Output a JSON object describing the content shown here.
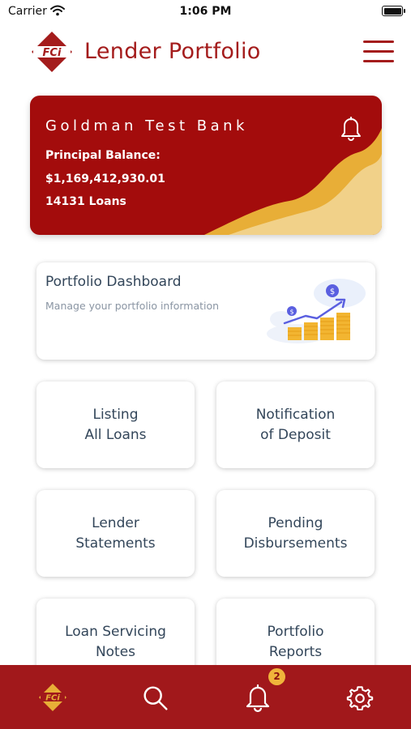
{
  "status_bar": {
    "carrier": "Carrier",
    "time": "1:06 PM"
  },
  "header": {
    "logo_text": "FCi",
    "title": "Lender Portfolio",
    "menu_icon": "hamburger-menu-icon"
  },
  "bank_card": {
    "bank_name": "Goldman Test Bank",
    "principal_label": "Principal Balance:",
    "principal_value": "$1,169,412,930.01",
    "loan_count": "14131 Loans",
    "bell_icon": "bell-icon"
  },
  "dashboard_card": {
    "title": "Portfolio Dashboard",
    "subtitle": "Manage your portfolio information",
    "illustration": "growth-coins-chart-illustration"
  },
  "tiles": [
    {
      "line1": "Listing",
      "line2": "All Loans"
    },
    {
      "line1": "Notification",
      "line2": "of Deposit"
    },
    {
      "line1": "Lender",
      "line2": "Statements"
    },
    {
      "line1": "Pending",
      "line2": "Disbursements"
    },
    {
      "line1": "Loan Servicing",
      "line2": "Notes"
    },
    {
      "line1": "Portfolio",
      "line2": "Reports"
    }
  ],
  "tab_bar": {
    "items": [
      {
        "icon": "fci-logo-icon"
      },
      {
        "icon": "search-icon"
      },
      {
        "icon": "bell-icon"
      },
      {
        "icon": "gear-icon"
      }
    ],
    "notification_count": "2"
  },
  "colors": {
    "brand_red": "#a41c1c",
    "card_red": "#a30c0c",
    "accent_gold": "#e8ae37",
    "light_gold": "#f1d189",
    "text_dark": "#33465a",
    "text_muted": "#8a95a3"
  }
}
